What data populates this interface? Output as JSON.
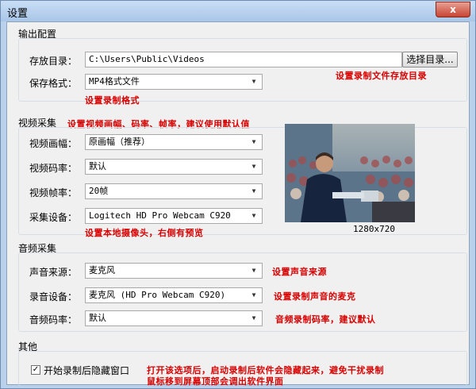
{
  "window": {
    "title": "设置",
    "close_glyph": "x"
  },
  "output": {
    "section_title": "输出配置",
    "dir_label": "存放目录：",
    "dir_value": "C:\\Users\\Public\\Videos",
    "browse_button": "选择目录...",
    "dir_hint": "设置录制文件存放目录",
    "format_label": "保存格式：",
    "format_value": "MP4格式文件",
    "format_hint": "设置录制格式"
  },
  "video": {
    "section_title": "视频采集",
    "section_hint": "设置视频画幅、码率、帧率，建议使用默认值",
    "resolution_label": "视频画幅：",
    "resolution_value": "原画幅（推荐）",
    "bitrate_label": "视频码率：",
    "bitrate_value": "默认",
    "framerate_label": "视频帧率：",
    "framerate_value": "20帧",
    "device_label": "采集设备：",
    "device_value": "Logitech HD Pro Webcam C920",
    "device_hint": "设置本地摄像头，右侧有预览",
    "preview_resolution": "1280x720"
  },
  "audio": {
    "section_title": "音频采集",
    "source_label": "声音来源：",
    "source_value": "麦克风",
    "source_hint": "设置声音来源",
    "device_label": "录音设备：",
    "device_value": "麦克风 (HD Pro Webcam C920)",
    "device_hint": "设置录制声音的麦克",
    "bitrate_label": "音频码率：",
    "bitrate_value": "默认",
    "bitrate_hint": "音频录制码率，建议默认"
  },
  "other": {
    "section_title": "其他",
    "hide_checkbox_label": "开始录制后隐藏窗口",
    "hide_checked": true,
    "hint_line1": "打开该选项后，启动录制后软件会隐藏起来，避免干扰录制",
    "hint_line2": "鼠标移到屏幕顶部会调出软件界面"
  },
  "colors": {
    "hint": "#d90000",
    "title_bar": "#b9d1ea",
    "panel": "#f0f0f0"
  },
  "icons": {
    "dropdown": "chevron-down-icon",
    "check": "checkmark-icon"
  }
}
